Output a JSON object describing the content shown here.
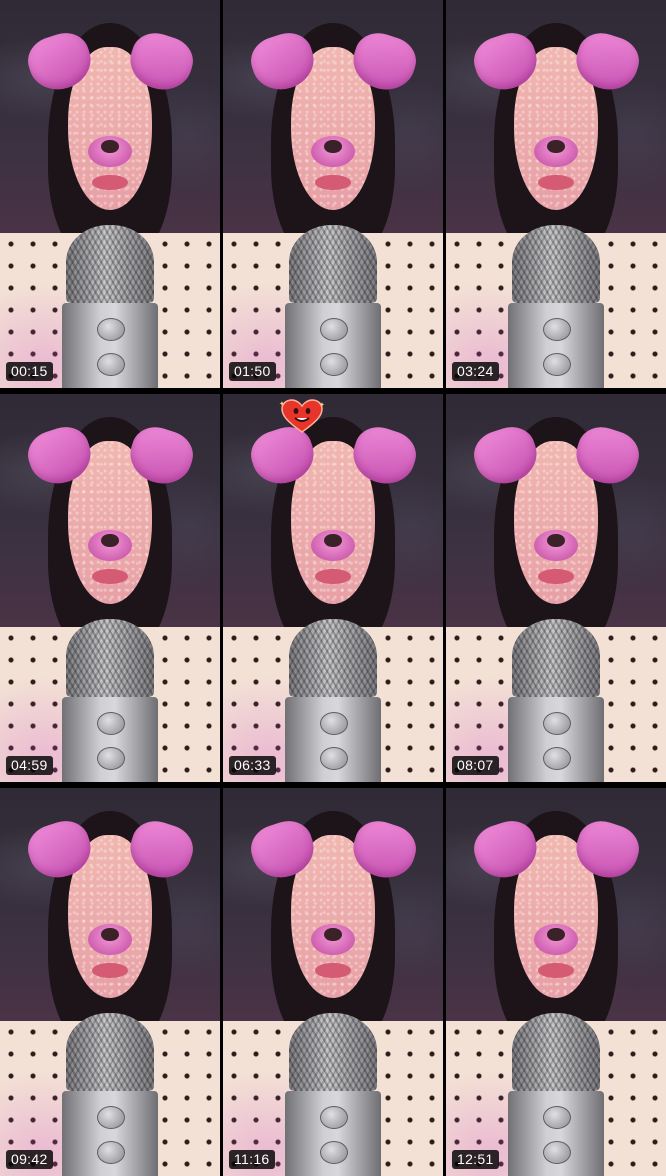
{
  "grid": {
    "tiles": [
      {
        "timestamp": "00:15"
      },
      {
        "timestamp": "01:50"
      },
      {
        "timestamp": "03:24"
      },
      {
        "timestamp": "04:59"
      },
      {
        "timestamp": "06:33",
        "sticker": "heart-face-icon"
      },
      {
        "timestamp": "08:07"
      },
      {
        "timestamp": "09:42"
      },
      {
        "timestamp": "11:16"
      },
      {
        "timestamp": "12:51"
      }
    ]
  },
  "colors": {
    "timestamp_bg": "#000000",
    "timestamp_text": "#ffffff",
    "ear_pink": "#e67ad0",
    "heart_red": "#e8352b"
  }
}
